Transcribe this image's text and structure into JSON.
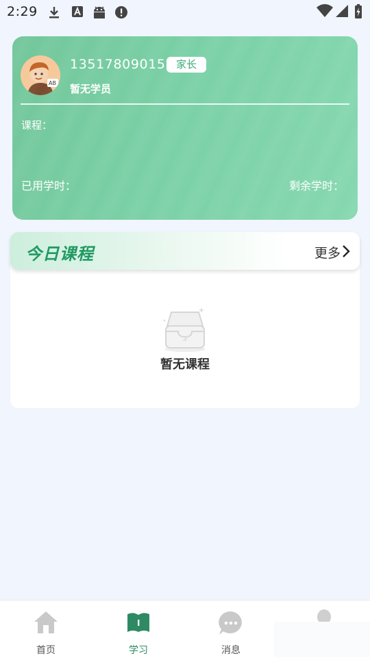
{
  "status_bar": {
    "time": "2:29"
  },
  "profile": {
    "phone": "13517809015",
    "role": "家长",
    "student": "暂无学员",
    "course_label": "课程：",
    "used_hours_label": "已用学时：",
    "remaining_hours_label": "剩余学时："
  },
  "today": {
    "title": "今日课程",
    "more": "更多",
    "empty_text": "暂无课程"
  },
  "bottom_nav": {
    "items": [
      {
        "label": "首页",
        "icon": "home-icon",
        "active": false
      },
      {
        "label": "学习",
        "icon": "book-icon",
        "active": true
      },
      {
        "label": "消息",
        "icon": "chat-bubble-icon",
        "active": false
      }
    ]
  },
  "colors": {
    "accent": "#1f9a62",
    "card": "#78cca2",
    "active_nav": "#2e8a63"
  }
}
